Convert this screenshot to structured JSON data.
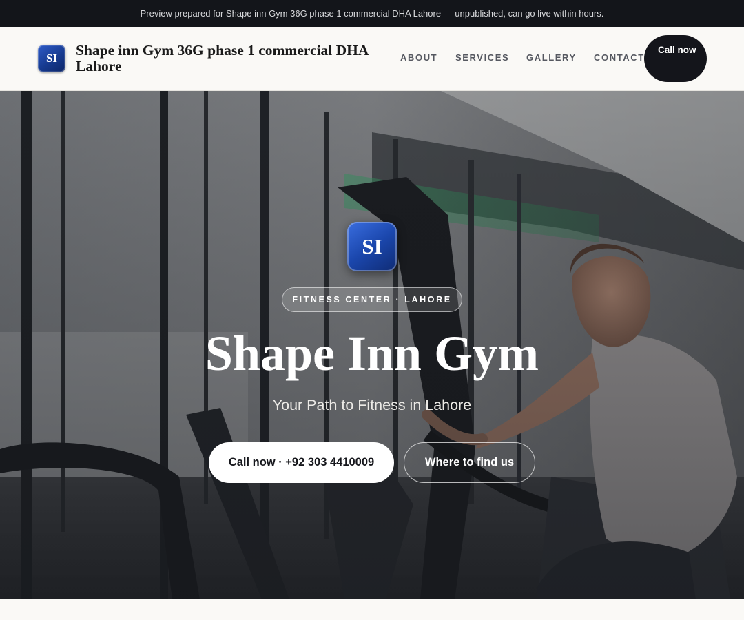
{
  "preview_bar": {
    "text": "Preview prepared for Shape inn Gym 36G phase 1 commercial DHA Lahore — unpublished, can go live within hours."
  },
  "header": {
    "logo_initials": "SI",
    "brand_name": "Shape inn Gym 36G phase 1 commercial DHA Lahore",
    "nav": {
      "about": "ABOUT",
      "services": "SERVICES",
      "gallery": "GALLERY",
      "contact": "CONTACT"
    },
    "call_button": "Call now"
  },
  "hero": {
    "logo_initials": "SI",
    "tagline_pill": "FITNESS CENTER · LAHORE",
    "title": "Shape Inn Gym",
    "subtitle": "Your Path to Fitness in Lahore",
    "primary_button": "Call now · +92 303 4410009",
    "secondary_button": "Where to find us"
  },
  "colors": {
    "preview_bar_bg": "#13151a",
    "header_bg": "#faf9f6",
    "call_button_bg": "#14151b",
    "brand_blue": "#1b47ad",
    "accent_green_light": "#3fbf78"
  }
}
